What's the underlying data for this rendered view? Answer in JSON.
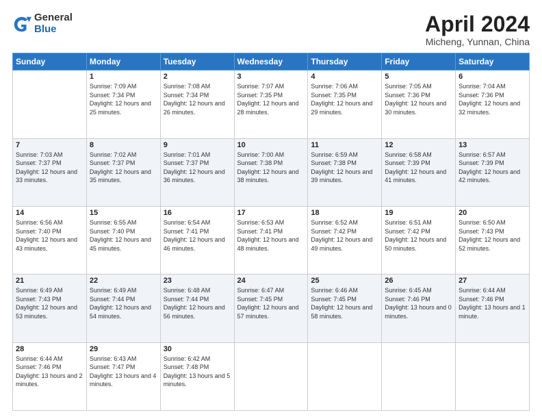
{
  "logo": {
    "general": "General",
    "blue": "Blue"
  },
  "title": "April 2024",
  "location": "Micheng, Yunnan, China",
  "days_of_week": [
    "Sunday",
    "Monday",
    "Tuesday",
    "Wednesday",
    "Thursday",
    "Friday",
    "Saturday"
  ],
  "weeks": [
    [
      {
        "day": "",
        "sunrise": "",
        "sunset": "",
        "daylight": ""
      },
      {
        "day": "1",
        "sunrise": "Sunrise: 7:09 AM",
        "sunset": "Sunset: 7:34 PM",
        "daylight": "Daylight: 12 hours and 25 minutes."
      },
      {
        "day": "2",
        "sunrise": "Sunrise: 7:08 AM",
        "sunset": "Sunset: 7:34 PM",
        "daylight": "Daylight: 12 hours and 26 minutes."
      },
      {
        "day": "3",
        "sunrise": "Sunrise: 7:07 AM",
        "sunset": "Sunset: 7:35 PM",
        "daylight": "Daylight: 12 hours and 28 minutes."
      },
      {
        "day": "4",
        "sunrise": "Sunrise: 7:06 AM",
        "sunset": "Sunset: 7:35 PM",
        "daylight": "Daylight: 12 hours and 29 minutes."
      },
      {
        "day": "5",
        "sunrise": "Sunrise: 7:05 AM",
        "sunset": "Sunset: 7:36 PM",
        "daylight": "Daylight: 12 hours and 30 minutes."
      },
      {
        "day": "6",
        "sunrise": "Sunrise: 7:04 AM",
        "sunset": "Sunset: 7:36 PM",
        "daylight": "Daylight: 12 hours and 32 minutes."
      }
    ],
    [
      {
        "day": "7",
        "sunrise": "Sunrise: 7:03 AM",
        "sunset": "Sunset: 7:37 PM",
        "daylight": "Daylight: 12 hours and 33 minutes."
      },
      {
        "day": "8",
        "sunrise": "Sunrise: 7:02 AM",
        "sunset": "Sunset: 7:37 PM",
        "daylight": "Daylight: 12 hours and 35 minutes."
      },
      {
        "day": "9",
        "sunrise": "Sunrise: 7:01 AM",
        "sunset": "Sunset: 7:37 PM",
        "daylight": "Daylight: 12 hours and 36 minutes."
      },
      {
        "day": "10",
        "sunrise": "Sunrise: 7:00 AM",
        "sunset": "Sunset: 7:38 PM",
        "daylight": "Daylight: 12 hours and 38 minutes."
      },
      {
        "day": "11",
        "sunrise": "Sunrise: 6:59 AM",
        "sunset": "Sunset: 7:38 PM",
        "daylight": "Daylight: 12 hours and 39 minutes."
      },
      {
        "day": "12",
        "sunrise": "Sunrise: 6:58 AM",
        "sunset": "Sunset: 7:39 PM",
        "daylight": "Daylight: 12 hours and 41 minutes."
      },
      {
        "day": "13",
        "sunrise": "Sunrise: 6:57 AM",
        "sunset": "Sunset: 7:39 PM",
        "daylight": "Daylight: 12 hours and 42 minutes."
      }
    ],
    [
      {
        "day": "14",
        "sunrise": "Sunrise: 6:56 AM",
        "sunset": "Sunset: 7:40 PM",
        "daylight": "Daylight: 12 hours and 43 minutes."
      },
      {
        "day": "15",
        "sunrise": "Sunrise: 6:55 AM",
        "sunset": "Sunset: 7:40 PM",
        "daylight": "Daylight: 12 hours and 45 minutes."
      },
      {
        "day": "16",
        "sunrise": "Sunrise: 6:54 AM",
        "sunset": "Sunset: 7:41 PM",
        "daylight": "Daylight: 12 hours and 46 minutes."
      },
      {
        "day": "17",
        "sunrise": "Sunrise: 6:53 AM",
        "sunset": "Sunset: 7:41 PM",
        "daylight": "Daylight: 12 hours and 48 minutes."
      },
      {
        "day": "18",
        "sunrise": "Sunrise: 6:52 AM",
        "sunset": "Sunset: 7:42 PM",
        "daylight": "Daylight: 12 hours and 49 minutes."
      },
      {
        "day": "19",
        "sunrise": "Sunrise: 6:51 AM",
        "sunset": "Sunset: 7:42 PM",
        "daylight": "Daylight: 12 hours and 50 minutes."
      },
      {
        "day": "20",
        "sunrise": "Sunrise: 6:50 AM",
        "sunset": "Sunset: 7:43 PM",
        "daylight": "Daylight: 12 hours and 52 minutes."
      }
    ],
    [
      {
        "day": "21",
        "sunrise": "Sunrise: 6:49 AM",
        "sunset": "Sunset: 7:43 PM",
        "daylight": "Daylight: 12 hours and 53 minutes."
      },
      {
        "day": "22",
        "sunrise": "Sunrise: 6:49 AM",
        "sunset": "Sunset: 7:44 PM",
        "daylight": "Daylight: 12 hours and 54 minutes."
      },
      {
        "day": "23",
        "sunrise": "Sunrise: 6:48 AM",
        "sunset": "Sunset: 7:44 PM",
        "daylight": "Daylight: 12 hours and 56 minutes."
      },
      {
        "day": "24",
        "sunrise": "Sunrise: 6:47 AM",
        "sunset": "Sunset: 7:45 PM",
        "daylight": "Daylight: 12 hours and 57 minutes."
      },
      {
        "day": "25",
        "sunrise": "Sunrise: 6:46 AM",
        "sunset": "Sunset: 7:45 PM",
        "daylight": "Daylight: 12 hours and 58 minutes."
      },
      {
        "day": "26",
        "sunrise": "Sunrise: 6:45 AM",
        "sunset": "Sunset: 7:46 PM",
        "daylight": "Daylight: 13 hours and 0 minutes."
      },
      {
        "day": "27",
        "sunrise": "Sunrise: 6:44 AM",
        "sunset": "Sunset: 7:46 PM",
        "daylight": "Daylight: 13 hours and 1 minute."
      }
    ],
    [
      {
        "day": "28",
        "sunrise": "Sunrise: 6:44 AM",
        "sunset": "Sunset: 7:46 PM",
        "daylight": "Daylight: 13 hours and 2 minutes."
      },
      {
        "day": "29",
        "sunrise": "Sunrise: 6:43 AM",
        "sunset": "Sunset: 7:47 PM",
        "daylight": "Daylight: 13 hours and 4 minutes."
      },
      {
        "day": "30",
        "sunrise": "Sunrise: 6:42 AM",
        "sunset": "Sunset: 7:48 PM",
        "daylight": "Daylight: 13 hours and 5 minutes."
      },
      {
        "day": "",
        "sunrise": "",
        "sunset": "",
        "daylight": ""
      },
      {
        "day": "",
        "sunrise": "",
        "sunset": "",
        "daylight": ""
      },
      {
        "day": "",
        "sunrise": "",
        "sunset": "",
        "daylight": ""
      },
      {
        "day": "",
        "sunrise": "",
        "sunset": "",
        "daylight": ""
      }
    ]
  ]
}
